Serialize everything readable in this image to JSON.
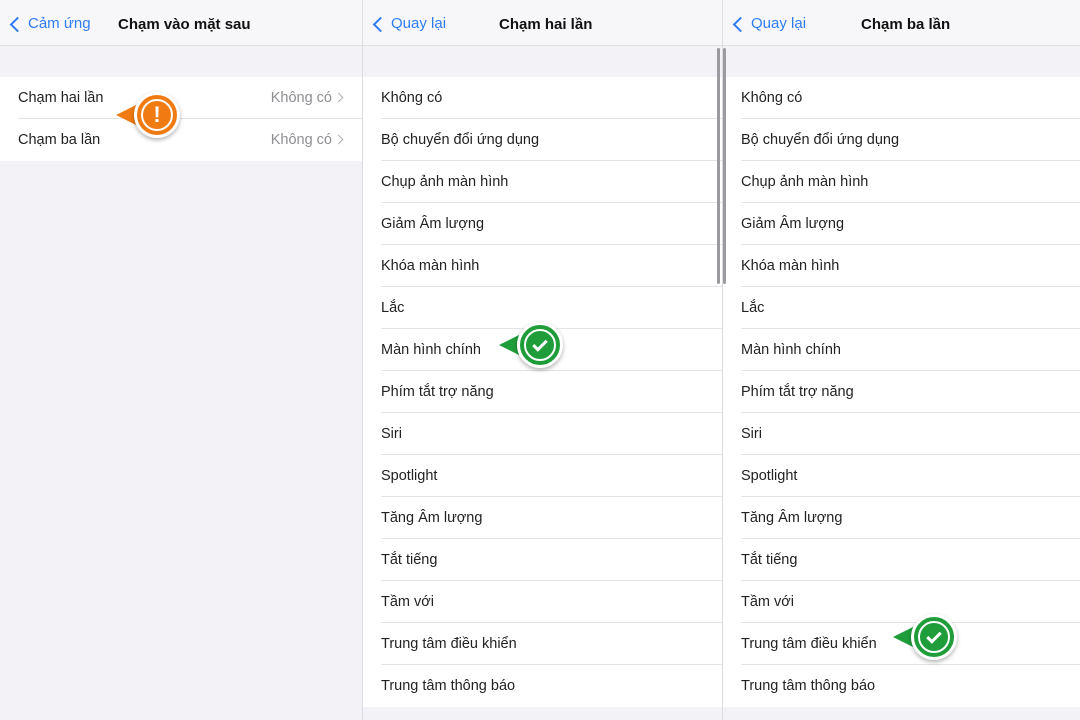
{
  "panel1": {
    "back_label": "Cảm ứng",
    "title": "Chạm vào mặt sau",
    "rows": [
      {
        "label": "Chạm hai lần",
        "value": "Không có"
      },
      {
        "label": "Chạm ba lần",
        "value": "Không có"
      }
    ]
  },
  "panel2": {
    "back_label": "Quay lại",
    "title": "Chạm hai lần",
    "options": [
      "Không có",
      "Bộ chuyển đổi ứng dụng",
      "Chụp ảnh màn hình",
      "Giảm Âm lượng",
      "Khóa màn hình",
      "Lắc",
      "Màn hình chính",
      "Phím tắt trợ năng",
      "Siri",
      "Spotlight",
      "Tăng Âm lượng",
      "Tắt tiếng",
      "Tầm với",
      "Trung tâm điều khiển",
      "Trung tâm thông báo"
    ]
  },
  "panel3": {
    "back_label": "Quay lại",
    "title": "Chạm ba lần",
    "options": [
      "Không có",
      "Bộ chuyển đổi ứng dụng",
      "Chụp ảnh màn hình",
      "Giảm Âm lượng",
      "Khóa màn hình",
      "Lắc",
      "Màn hình chính",
      "Phím tắt trợ năng",
      "Siri",
      "Spotlight",
      "Tăng Âm lượng",
      "Tắt tiếng",
      "Tầm với",
      "Trung tâm điều khiển",
      "Trung tâm thông báo"
    ]
  },
  "badges": {
    "warn_symbol": "!",
    "warn_icon": "exclamation-icon",
    "ok_icon": "checkmark-icon"
  },
  "colors": {
    "accent": "#2f7cf6",
    "warning": "#f07b12",
    "success": "#1f9d3a"
  }
}
